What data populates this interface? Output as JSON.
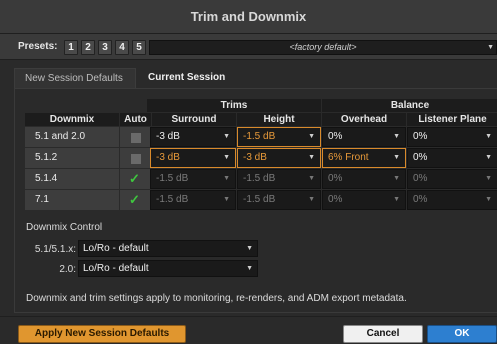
{
  "window": {
    "title": "Trim and Downmix"
  },
  "presets": {
    "label": "Presets:",
    "buttons": [
      "1",
      "2",
      "3",
      "4",
      "5"
    ],
    "selected_value": "<factory default>"
  },
  "tabs": [
    {
      "label": "New Session Defaults",
      "active": false
    },
    {
      "label": "Current Session",
      "active": true
    }
  ],
  "table": {
    "group_headers": {
      "trims": "Trims",
      "balance": "Balance"
    },
    "columns": {
      "downmix": "Downmix",
      "auto": "Auto",
      "surround": "Surround",
      "height": "Height",
      "overhead": "Overhead",
      "listener_plane": "Listener Plane"
    },
    "rows": [
      {
        "downmix": "5.1 and 2.0",
        "auto": "unchecked",
        "surround": "-3 dB",
        "height": "-1.5 dB",
        "overhead": "0%",
        "listener_plane": "0%"
      },
      {
        "downmix": "5.1.2",
        "auto": "unchecked",
        "surround": "-3 dB",
        "height": "-3 dB",
        "overhead": "6% Front",
        "listener_plane": "0%"
      },
      {
        "downmix": "5.1.4",
        "auto": "checked",
        "surround": "-1.5 dB",
        "height": "-1.5 dB",
        "overhead": "0%",
        "listener_plane": "0%"
      },
      {
        "downmix": "7.1",
        "auto": "checked",
        "surround": "-1.5 dB",
        "height": "-1.5 dB",
        "overhead": "0%",
        "listener_plane": "0%"
      }
    ]
  },
  "downmix_control": {
    "title": "Downmix Control",
    "items": [
      {
        "label": "5.1/5.1.x:",
        "value": "Lo/Ro - default"
      },
      {
        "label": "2.0:",
        "value": "Lo/Ro - default"
      }
    ]
  },
  "footnote": "Downmix and trim settings apply to monitoring, re-renders, and ADM export metadata.",
  "buttons": {
    "apply": "Apply New Session Defaults",
    "cancel": "Cancel",
    "ok": "OK"
  },
  "colors": {
    "accent_orange": "#e0962f",
    "ok_blue": "#2d7fd0",
    "check_green": "#3fc63f"
  }
}
